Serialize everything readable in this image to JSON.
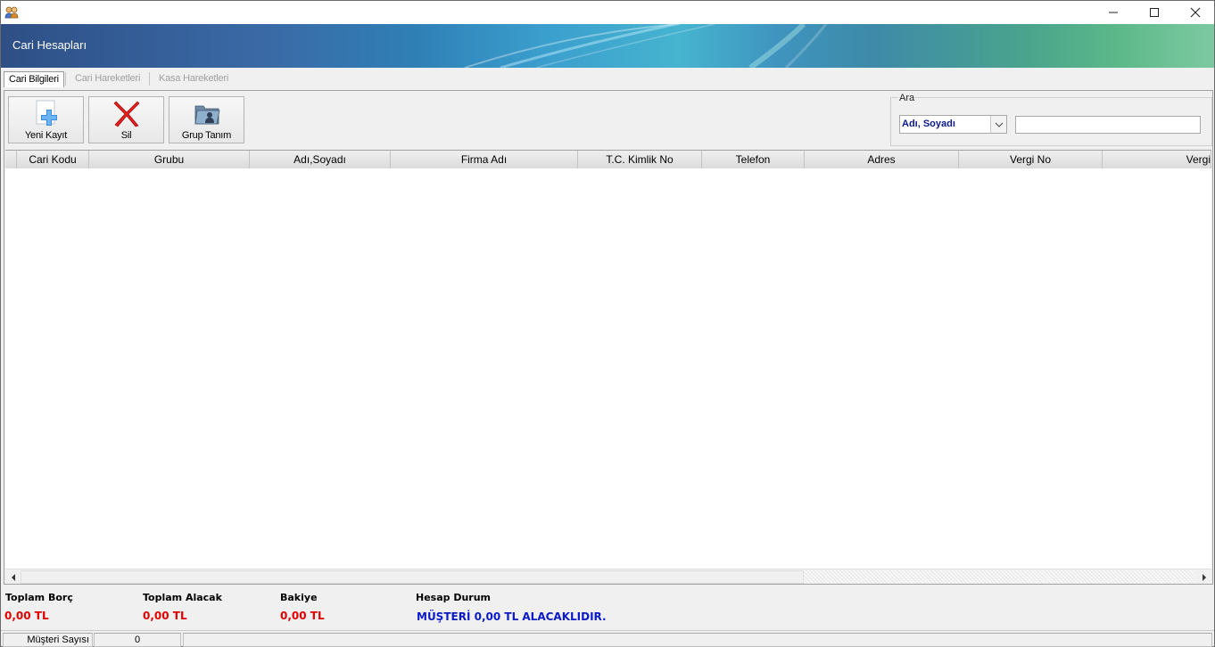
{
  "window": {
    "title": ""
  },
  "header": {
    "title": "Cari Hesapları"
  },
  "tabs": [
    {
      "label": "Cari Bilgileri",
      "active": true
    },
    {
      "label": "Cari Hareketleri",
      "active": false
    },
    {
      "label": "Kasa Hareketleri",
      "active": false
    }
  ],
  "toolbar": {
    "new_label": "Yeni Kayıt",
    "delete_label": "Sil",
    "group_label": "Grup Tanım"
  },
  "search": {
    "legend": "Ara",
    "field_selected": "Adı, Soyadı",
    "query": ""
  },
  "grid": {
    "columns": [
      "Cari Kodu",
      "Grubu",
      "Adı,Soyadı",
      "Firma Adı",
      "T.C. Kimlik No",
      "Telefon",
      "Adres",
      "Vergi No",
      "Vergi"
    ],
    "rows": []
  },
  "summary": {
    "total_debt_label": "Toplam Borç",
    "total_debt_value": "0,00 TL",
    "total_credit_label": "Toplam Alacak",
    "total_credit_value": "0,00 TL",
    "balance_label": "Bakiye",
    "balance_value": "0,00 TL",
    "status_label": "Hesap Durum",
    "status_value": "MÜŞTERİ 0,00 TL ALACAKLIDIR."
  },
  "statusbar": {
    "customer_count_label": "Müşteri Sayısı",
    "customer_count": "0"
  },
  "colors": {
    "value_red": "#e00000",
    "status_blue": "#0a1ac8",
    "select_text": "#0a1a8a"
  }
}
